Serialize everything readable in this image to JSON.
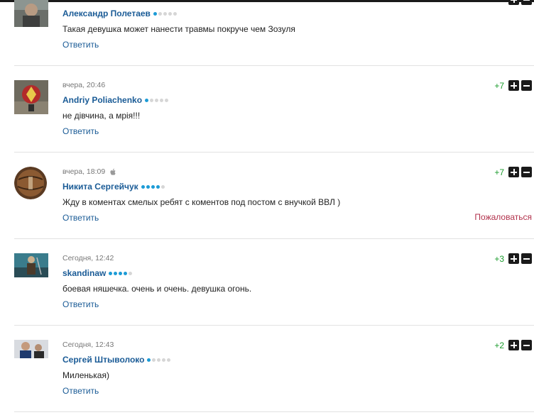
{
  "comments": [
    {
      "meta": "",
      "author": "Александр Полетаев",
      "rating_dots": 1,
      "text": "Такая девушка может нанести травмы покруче чем Зозуля",
      "reply": "Ответить",
      "score": "",
      "avatar_icon": "avatar-photo-man"
    },
    {
      "meta": "вчера, 20:46",
      "author": "Andriy Poliachenko",
      "rating_dots": 1,
      "text": "не дівчина, а мрія!!!",
      "reply": "Ответить",
      "score": "+7",
      "avatar_icon": "avatar-emblem"
    },
    {
      "meta": "вчера, 18:09",
      "meta_icon": "apple-icon",
      "author": "Никита Сергейчук",
      "rating_dots": 4,
      "text": "Жду в коментах смелых ребят с коментов под постом с внучкой ВВЛ )",
      "reply": "Ответить",
      "report": "Пожаловаться",
      "score": "+7",
      "avatar_icon": "avatar-football"
    },
    {
      "meta": "Сегодня, 12:42",
      "author": "skandinaw",
      "rating_dots": 4,
      "text": "боевая няшечка. очень и очень. девушка огонь.",
      "reply": "Ответить",
      "score": "+3",
      "avatar_icon": "avatar-warrior"
    },
    {
      "meta": "Сегодня, 12:43",
      "author": "Сергей Штыволоко",
      "rating_dots": 1,
      "text": "Миленькая)",
      "reply": "Ответить",
      "score": "+2",
      "avatar_icon": "avatar-photo-man-2"
    }
  ],
  "colors": {
    "author": "#1a5b96",
    "score": "#1a9b2c",
    "report": "#b2324c",
    "dot_active": "#1c9bd6"
  }
}
